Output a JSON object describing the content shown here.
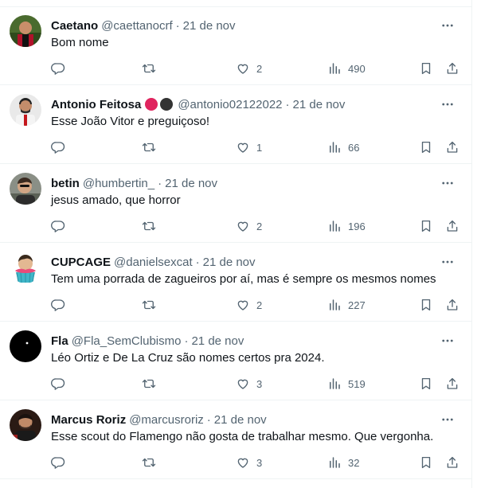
{
  "tweets": [
    {
      "name": "Caetano",
      "handle": "@caettanocrf",
      "separator": "·",
      "date": "21 de nov",
      "text": "Bom nome",
      "likes": "2",
      "views": "490",
      "avatar": "caetano"
    },
    {
      "name": "Antonio Feitosa",
      "handle": "@antonio02122022",
      "separator": "·",
      "date": "21 de nov",
      "text": "Esse João Vitor e preguiçoso!",
      "likes": "1",
      "views": "66",
      "avatar": "antonio",
      "name_emoji": [
        "red-circle",
        "black-circle"
      ]
    },
    {
      "name": "betin",
      "handle": "@humbertin_",
      "separator": "·",
      "date": "21 de nov",
      "text": "jesus amado, que horror",
      "likes": "2",
      "views": "196",
      "avatar": "betin"
    },
    {
      "name": "CUPCAGE",
      "handle": "@danielsexcat",
      "separator": "·",
      "date": "21 de nov",
      "text": "Tem uma porrada de zagueiros por aí, mas é sempre os mesmos nomes",
      "likes": "2",
      "views": "227",
      "avatar": "cupcage"
    },
    {
      "name": "Fla",
      "handle": "@Fla_SemClubismo",
      "separator": "·",
      "date": "21 de nov",
      "text": "Léo Ortiz e De La Cruz são nomes certos pra 2024.",
      "likes": "3",
      "views": "519",
      "avatar": "fla"
    },
    {
      "name": "Marcus Roriz",
      "handle": "@marcusroriz",
      "separator": "·",
      "date": "21 de nov",
      "text": "Esse scout do Flamengo não gosta de trabalhar mesmo. Que vergonha.",
      "likes": "3",
      "views": "32",
      "avatar": "marcus"
    }
  ],
  "icons": {
    "more": "more-horizontal-icon",
    "reply": "reply-icon",
    "retweet": "retweet-icon",
    "like": "heart-icon",
    "views": "views-chart-icon",
    "bookmark": "bookmark-icon",
    "share": "share-icon"
  },
  "colors": {
    "text": "#0f1419",
    "secondary": "#536471",
    "divider": "#eff3f4",
    "emoji_red": "#e0245e",
    "emoji_black": "#333333"
  }
}
